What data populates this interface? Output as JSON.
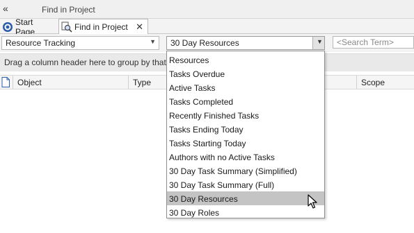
{
  "window": {
    "title": "Find in Project"
  },
  "tabs": [
    {
      "label": "Start Page",
      "active": false
    },
    {
      "label": "Find in Project",
      "active": true
    }
  ],
  "toolbar": {
    "category_value": "Resource Tracking",
    "search_value": "30 Day Resources",
    "search_term_placeholder": "<Search Term>"
  },
  "group_bar": {
    "text": "Drag a column header here to group by that column"
  },
  "columns": [
    "Object",
    "Type",
    "Scope"
  ],
  "dropdown": {
    "items": [
      "Resources",
      "Tasks Overdue",
      "Active Tasks",
      "Tasks Completed",
      "Recently Finished Tasks",
      "Tasks Ending Today",
      "Tasks Starting Today",
      "Authors with no Active Tasks",
      "30 Day Task Summary (Simplified)",
      "30 Day Task Summary (Full)",
      "30 Day Resources",
      "30 Day Roles"
    ],
    "selected": "30 Day Resources"
  },
  "colors": {
    "selection": "#c4c4c4",
    "tab_icon_blue": "#2a5caa"
  }
}
